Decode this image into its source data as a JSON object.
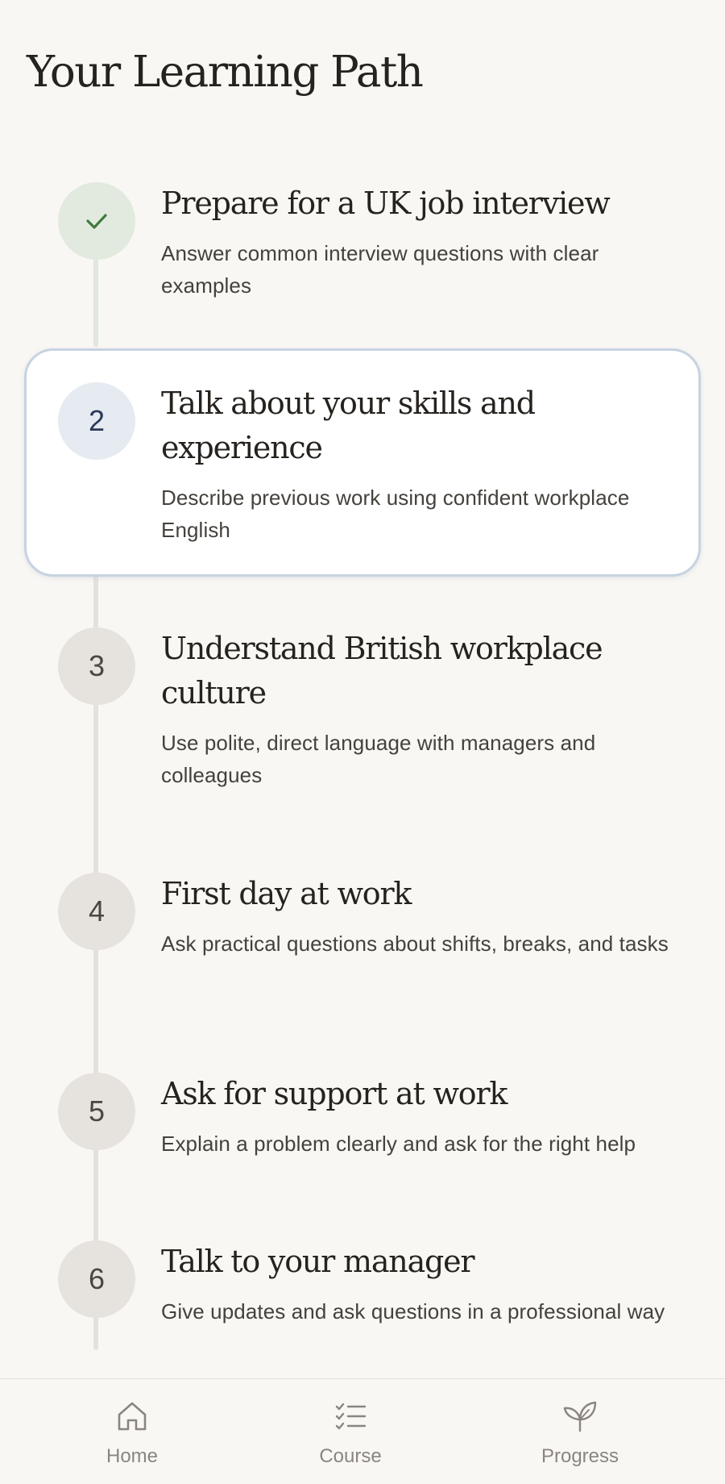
{
  "header": {
    "title": "Your Learning Path"
  },
  "steps": [
    {
      "number": "",
      "status": "completed",
      "title": "Prepare for a UK job interview",
      "description": "Answer common interview questions with clear examples"
    },
    {
      "number": "2",
      "status": "current",
      "title": "Talk about your skills and experience",
      "description": "Describe previous work using confident workplace English"
    },
    {
      "number": "3",
      "status": "locked",
      "title": "Understand British workplace culture",
      "description": "Use polite, direct language with managers and colleagues"
    },
    {
      "number": "4",
      "status": "locked",
      "title": "First day at work",
      "description": "Ask practical questions about shifts, breaks, and tasks"
    },
    {
      "number": "5",
      "status": "locked",
      "title": "Ask for support at work",
      "description": "Explain a problem clearly and ask for the right help"
    },
    {
      "number": "6",
      "status": "locked",
      "title": "Talk to your manager",
      "description": "Give updates and ask questions in a professional way"
    }
  ],
  "nav": {
    "items": [
      {
        "label": "Home",
        "icon": "home-icon"
      },
      {
        "label": "Course",
        "icon": "checklist-icon"
      },
      {
        "label": "Progress",
        "icon": "leaf-icon"
      }
    ]
  },
  "colors": {
    "background": "#f9f7f4",
    "completed_circle": "#e2eadf",
    "check": "#3f7a3c",
    "current_circle": "#e6eaf1",
    "current_border": "#c7d3e1",
    "locked_circle": "#e6e3de",
    "nav_text": "#8a8580"
  }
}
